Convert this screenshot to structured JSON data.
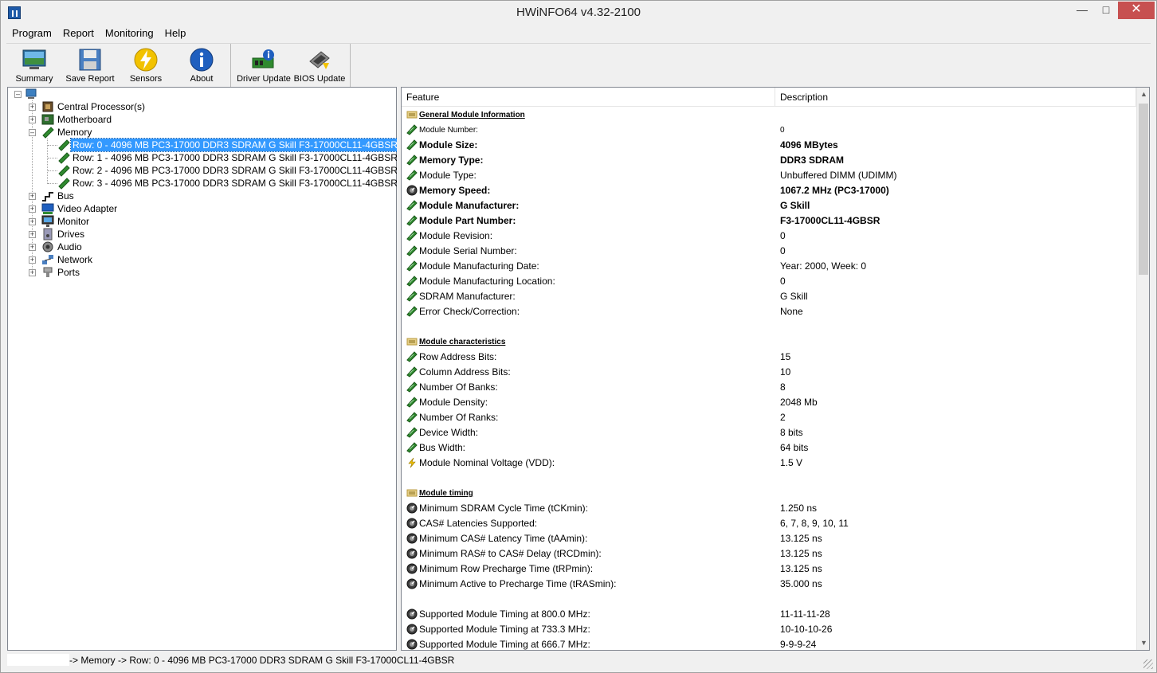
{
  "window": {
    "title": "HWiNFO64 v4.32-2100"
  },
  "menu": [
    {
      "label": "Program"
    },
    {
      "label": "Report"
    },
    {
      "label": "Monitoring"
    },
    {
      "label": "Help"
    }
  ],
  "toolbar": [
    {
      "label": "Summary",
      "icon": "summary-icon"
    },
    {
      "label": "Save Report",
      "icon": "save-icon"
    },
    {
      "label": "Sensors",
      "icon": "sensors-icon"
    },
    {
      "label": "About",
      "icon": "info-icon"
    },
    {
      "label": "Driver Update",
      "icon": "driver-update-icon"
    },
    {
      "label": "BIOS Update",
      "icon": "bios-update-icon"
    }
  ],
  "tree": {
    "root_icon": "computer-icon",
    "items": [
      {
        "label": "Central Processor(s)",
        "icon": "cpu-icon",
        "expander": "+"
      },
      {
        "label": "Motherboard",
        "icon": "motherboard-icon",
        "expander": "+"
      },
      {
        "label": "Memory",
        "icon": "memory-icon",
        "expander": "-"
      },
      {
        "label": "Row: 0 - 4096 MB PC3-17000 DDR3 SDRAM G Skill F3-17000CL11-4GBSR",
        "icon": "ram-icon",
        "selected": true
      },
      {
        "label": "Row: 1 - 4096 MB PC3-17000 DDR3 SDRAM G Skill F3-17000CL11-4GBSR",
        "icon": "ram-icon"
      },
      {
        "label": "Row: 2 - 4096 MB PC3-17000 DDR3 SDRAM G Skill F3-17000CL11-4GBSR",
        "icon": "ram-icon"
      },
      {
        "label": "Row: 3 - 4096 MB PC3-17000 DDR3 SDRAM G Skill F3-17000CL11-4GBSR",
        "icon": "ram-icon"
      },
      {
        "label": "Bus",
        "icon": "bus-icon",
        "expander": "+"
      },
      {
        "label": "Video Adapter",
        "icon": "video-adapter-icon",
        "expander": "+"
      },
      {
        "label": "Monitor",
        "icon": "monitor-icon",
        "expander": "+"
      },
      {
        "label": "Drives",
        "icon": "drives-icon",
        "expander": "+"
      },
      {
        "label": "Audio",
        "icon": "audio-icon",
        "expander": "+"
      },
      {
        "label": "Network",
        "icon": "network-icon",
        "expander": "+"
      },
      {
        "label": "Ports",
        "icon": "ports-icon",
        "expander": "+"
      }
    ]
  },
  "list": {
    "columns": [
      "Feature",
      "Description"
    ],
    "rows": [
      {
        "feature": "General Module Information",
        "description": "",
        "kind": "section",
        "icon": "section-icon"
      },
      {
        "feature": "Module Number:",
        "description": "0",
        "kind": "small",
        "icon": "ram-icon"
      },
      {
        "feature": "Module Size:",
        "description": "4096 MBytes",
        "kind": "bold",
        "icon": "ram-icon"
      },
      {
        "feature": "Memory Type:",
        "description": "DDR3 SDRAM",
        "kind": "bold",
        "icon": "ram-icon"
      },
      {
        "feature": "Module Type:",
        "description": "Unbuffered DIMM (UDIMM)",
        "kind": "normal",
        "icon": "ram-icon"
      },
      {
        "feature": "Memory Speed:",
        "description": "1067.2 MHz (PC3-17000)",
        "kind": "bold",
        "icon": "gauge-icon"
      },
      {
        "feature": "Module Manufacturer:",
        "description": "G Skill",
        "kind": "bold",
        "icon": "ram-icon"
      },
      {
        "feature": "Module Part Number:",
        "description": "F3-17000CL11-4GBSR",
        "kind": "bold",
        "icon": "ram-icon"
      },
      {
        "feature": "Module Revision:",
        "description": "0",
        "kind": "normal",
        "icon": "ram-icon"
      },
      {
        "feature": "Module Serial Number:",
        "description": "0",
        "kind": "normal",
        "icon": "ram-icon"
      },
      {
        "feature": "Module Manufacturing Date:",
        "description": "Year: 2000, Week: 0",
        "kind": "normal",
        "icon": "ram-icon"
      },
      {
        "feature": "Module Manufacturing Location:",
        "description": "0",
        "kind": "normal",
        "icon": "ram-icon"
      },
      {
        "feature": "SDRAM Manufacturer:",
        "description": "G Skill",
        "kind": "normal",
        "icon": "ram-icon"
      },
      {
        "feature": "Error Check/Correction:",
        "description": "None",
        "kind": "normal",
        "icon": "ram-icon"
      },
      {
        "feature": "",
        "description": "",
        "kind": "blank"
      },
      {
        "feature": "Module characteristics",
        "description": "",
        "kind": "section",
        "icon": "section-icon"
      },
      {
        "feature": "Row Address Bits:",
        "description": "15",
        "kind": "normal",
        "icon": "ram-icon"
      },
      {
        "feature": "Column Address Bits:",
        "description": "10",
        "kind": "normal",
        "icon": "ram-icon"
      },
      {
        "feature": "Number Of Banks:",
        "description": "8",
        "kind": "normal",
        "icon": "ram-icon"
      },
      {
        "feature": "Module Density:",
        "description": "2048 Mb",
        "kind": "normal",
        "icon": "ram-icon"
      },
      {
        "feature": "Number Of Ranks:",
        "description": "2",
        "kind": "normal",
        "icon": "ram-icon"
      },
      {
        "feature": "Device Width:",
        "description": "8 bits",
        "kind": "normal",
        "icon": "ram-icon"
      },
      {
        "feature": "Bus Width:",
        "description": "64 bits",
        "kind": "normal",
        "icon": "ram-icon"
      },
      {
        "feature": "Module Nominal Voltage (VDD):",
        "description": "1.5 V",
        "kind": "normal",
        "icon": "voltage-icon"
      },
      {
        "feature": "",
        "description": "",
        "kind": "blank"
      },
      {
        "feature": "Module timing",
        "description": "",
        "kind": "section",
        "icon": "section-icon"
      },
      {
        "feature": "Minimum SDRAM Cycle Time (tCKmin):",
        "description": "1.250 ns",
        "kind": "normal",
        "icon": "gauge-icon"
      },
      {
        "feature": "CAS# Latencies Supported:",
        "description": "6, 7, 8, 9, 10, 11",
        "kind": "normal",
        "icon": "gauge-icon"
      },
      {
        "feature": "Minimum CAS# Latency Time (tAAmin):",
        "description": "13.125 ns",
        "kind": "normal",
        "icon": "gauge-icon"
      },
      {
        "feature": "Minimum RAS# to CAS# Delay (tRCDmin):",
        "description": "13.125 ns",
        "kind": "normal",
        "icon": "gauge-icon"
      },
      {
        "feature": "Minimum Row Precharge Time (tRPmin):",
        "description": "13.125 ns",
        "kind": "normal",
        "icon": "gauge-icon"
      },
      {
        "feature": "Minimum Active to Precharge Time (tRASmin):",
        "description": "35.000 ns",
        "kind": "normal",
        "icon": "gauge-icon"
      },
      {
        "feature": "",
        "description": "",
        "kind": "blank"
      },
      {
        "feature": "Supported Module Timing at 800.0 MHz:",
        "description": "11-11-11-28",
        "kind": "normal",
        "icon": "gauge-icon"
      },
      {
        "feature": "Supported Module Timing at 733.3 MHz:",
        "description": "10-10-10-26",
        "kind": "normal",
        "icon": "gauge-icon"
      },
      {
        "feature": "Supported Module Timing at 666.7 MHz:",
        "description": "9-9-9-24",
        "kind": "normal",
        "icon": "gauge-icon"
      }
    ]
  },
  "status": {
    "path": "-> Memory -> Row: 0 - 4096 MB PC3-17000 DDR3 SDRAM G Skill F3-17000CL11-4GBSR"
  },
  "colors": {
    "selection": "#3399ff",
    "close_button": "#c75050",
    "ram_green": "#2f8a2f"
  }
}
